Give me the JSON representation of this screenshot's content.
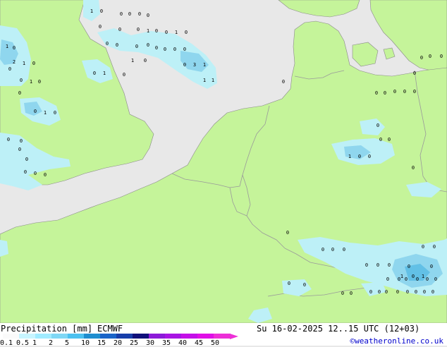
{
  "title": "Precipitation [mm]",
  "model": "ECMWF",
  "datetime": "Su 16-02-2025 12..15 UTC (12+03)",
  "credit": "©weatheronline.co.uk",
  "colors": {
    "sea": "#e8e8e8",
    "land": "#c5f49a",
    "border": "#999999",
    "light_precip": "#bdf0f7",
    "moderate_precip": "#8fd6ee",
    "heavier_precip": "#62c0e6"
  },
  "legend": {
    "ticks": [
      "0.1",
      "0.5",
      "1",
      "2",
      "5",
      "10",
      "15",
      "20",
      "25",
      "30",
      "35",
      "40",
      "45",
      "50"
    ],
    "colors": [
      "#fafafa",
      "#c7f5ff",
      "#a0ebff",
      "#7fd7f5",
      "#4cc1f0",
      "#1f8ecf",
      "#1a64c8",
      "#173ea9",
      "#10107a",
      "#8c1ad8",
      "#a814e3",
      "#c40fe8",
      "#e00fe6",
      "#ed2fd7"
    ]
  },
  "station_values": [
    {
      "text": "1"
    },
    {
      "text": "0"
    },
    {
      "text": "0"
    },
    {
      "text": "0"
    },
    {
      "text": "0"
    },
    {
      "text": "0"
    },
    {
      "text": "0"
    },
    {
      "text": "0"
    },
    {
      "text": "0"
    },
    {
      "text": "1"
    },
    {
      "text": "0"
    },
    {
      "text": "0"
    },
    {
      "text": "1"
    },
    {
      "text": "0"
    },
    {
      "text": "0"
    },
    {
      "text": "0"
    },
    {
      "text": "0"
    },
    {
      "text": "0"
    },
    {
      "text": "0"
    },
    {
      "text": "0"
    },
    {
      "text": "0"
    },
    {
      "text": "0"
    },
    {
      "text": "1"
    },
    {
      "text": "0"
    },
    {
      "text": "0"
    },
    {
      "text": "3"
    },
    {
      "text": "1"
    },
    {
      "text": "1"
    },
    {
      "text": "1"
    },
    {
      "text": "1"
    },
    {
      "text": "0"
    },
    {
      "text": "2"
    },
    {
      "text": "1"
    },
    {
      "text": "0"
    },
    {
      "text": "0"
    },
    {
      "text": "1"
    },
    {
      "text": "0"
    },
    {
      "text": "0"
    },
    {
      "text": "0"
    },
    {
      "text": "1"
    },
    {
      "text": "0"
    },
    {
      "text": "0"
    },
    {
      "text": "0"
    },
    {
      "text": "1"
    },
    {
      "text": "0"
    },
    {
      "text": "0"
    },
    {
      "text": "0"
    },
    {
      "text": "0"
    },
    {
      "text": "0"
    },
    {
      "text": "0"
    },
    {
      "text": "0"
    },
    {
      "text": "0"
    },
    {
      "text": "0"
    },
    {
      "text": "0"
    },
    {
      "text": "0"
    },
    {
      "text": "0"
    },
    {
      "text": "0"
    },
    {
      "text": "0"
    },
    {
      "text": "0"
    },
    {
      "text": "0"
    },
    {
      "text": "0"
    },
    {
      "text": "0"
    },
    {
      "text": "0"
    },
    {
      "text": "1"
    },
    {
      "text": "0"
    },
    {
      "text": "0"
    },
    {
      "text": "0"
    },
    {
      "text": "0"
    },
    {
      "text": "0"
    },
    {
      "text": "0"
    },
    {
      "text": "0"
    },
    {
      "text": "0"
    },
    {
      "text": "0"
    },
    {
      "text": "0"
    },
    {
      "text": "0"
    },
    {
      "text": "0"
    },
    {
      "text": "0"
    },
    {
      "text": "0"
    },
    {
      "text": "0"
    },
    {
      "text": "0"
    },
    {
      "text": "0"
    },
    {
      "text": "0"
    },
    {
      "text": "0"
    },
    {
      "text": "0"
    },
    {
      "text": "1"
    },
    {
      "text": "0"
    },
    {
      "text": "1"
    },
    {
      "text": "0"
    },
    {
      "text": "0"
    },
    {
      "text": "0"
    },
    {
      "text": "0"
    },
    {
      "text": "0"
    },
    {
      "text": "0"
    },
    {
      "text": "0"
    },
    {
      "text": "0"
    },
    {
      "text": "0"
    },
    {
      "text": "0"
    },
    {
      "text": "0"
    },
    {
      "text": "0"
    },
    {
      "text": "0"
    },
    {
      "text": "0"
    }
  ]
}
